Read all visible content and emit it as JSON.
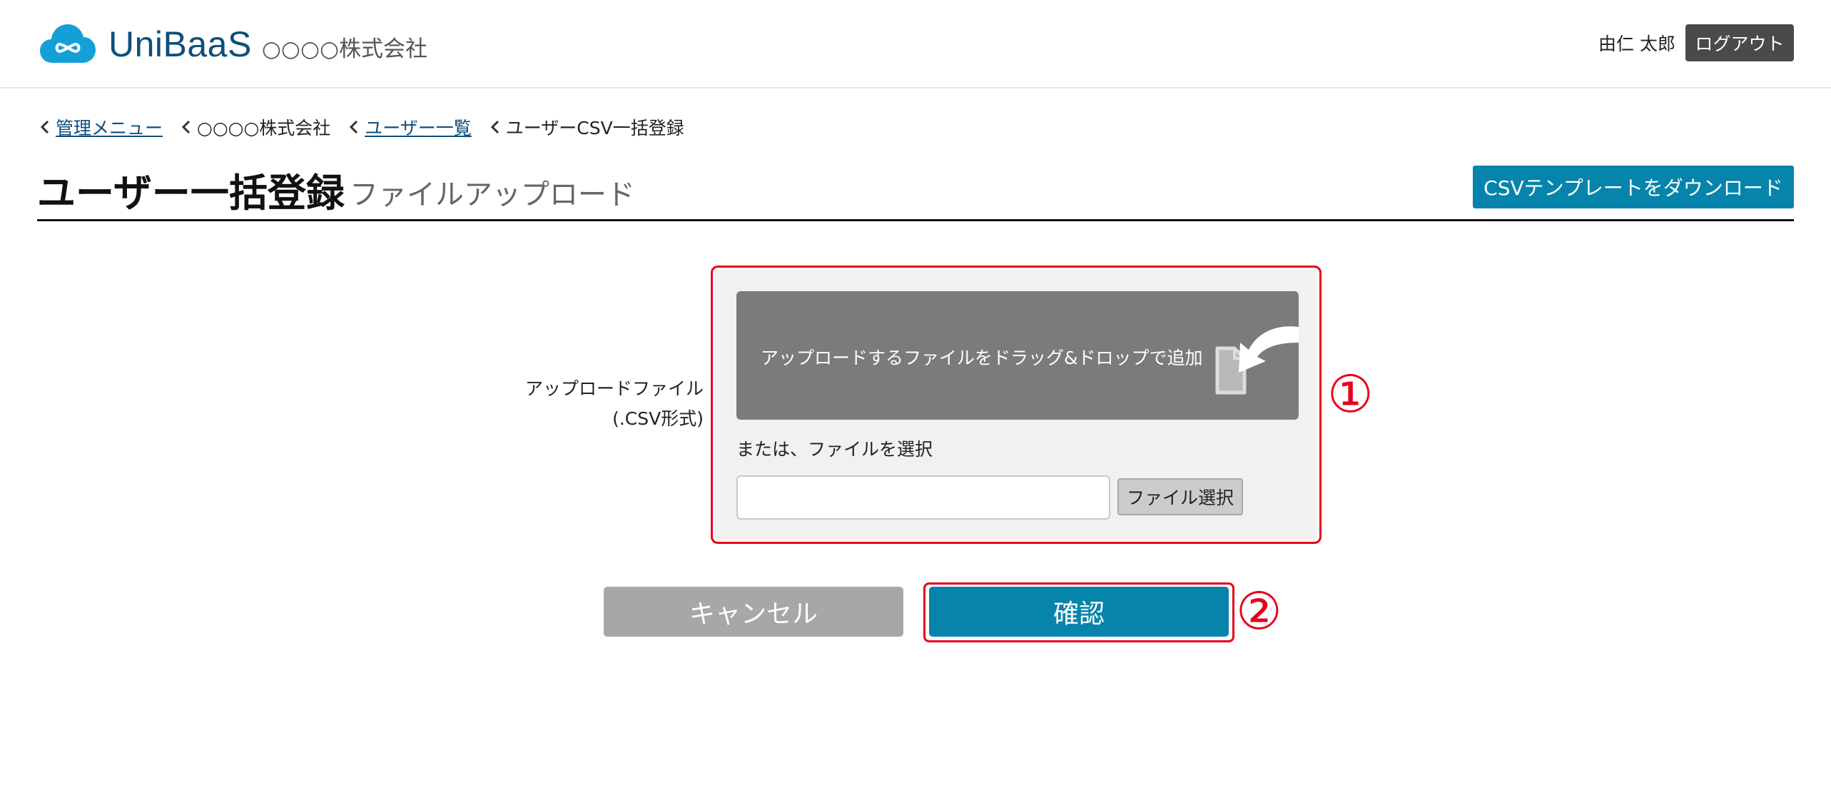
{
  "header": {
    "brand": "UniBaaS",
    "company": "○○○○株式会社",
    "user_name": "由仁 太郎",
    "logout_label": "ログアウト",
    "brand_color": "#0d4f7c",
    "logo_icon": "cloud-infinity-icon"
  },
  "breadcrumb": [
    {
      "label": "管理メニュー",
      "link": true
    },
    {
      "label": "○○○○株式会社",
      "link": false
    },
    {
      "label": "ユーザー一覧",
      "link": true
    },
    {
      "label": "ユーザーCSV一括登録",
      "link": false
    }
  ],
  "page": {
    "title": "ユーザー一括登録",
    "subtitle": "ファイルアップロード",
    "template_button": "CSVテンプレートをダウンロード"
  },
  "upload": {
    "label_line1": "アップロードファイル",
    "label_line2": "(.CSV形式)",
    "dropzone_text": "アップロードするファイルをドラッグ&ドロップで追加",
    "or_text": "または、ファイルを選択",
    "file_input_value": "",
    "file_button": "ファイル選択"
  },
  "actions": {
    "cancel_label": "キャンセル",
    "confirm_label": "確認"
  },
  "annotations": {
    "marker_1": "①",
    "marker_2": "②",
    "color": "#e8001c"
  },
  "colors": {
    "accent": "#0784ab",
    "dropzone": "#7b7b7b",
    "logout": "#4a4a4a"
  }
}
